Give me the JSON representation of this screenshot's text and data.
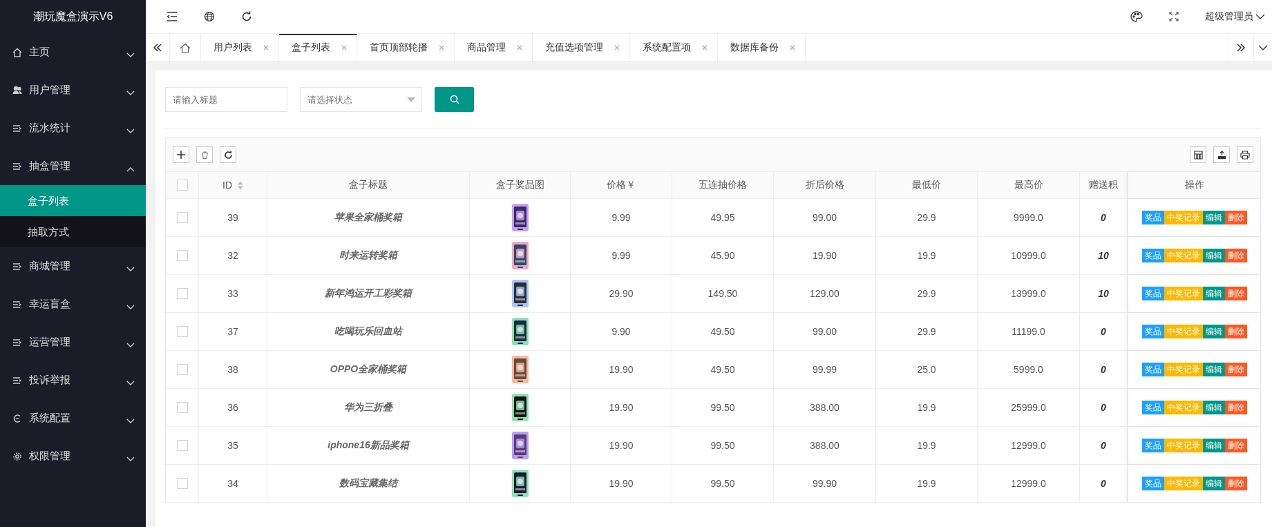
{
  "sidebar": {
    "title": "潮玩魔盒演示V6",
    "items": [
      {
        "label": "主页",
        "kind": "home",
        "expanded": false
      },
      {
        "label": "用户管理",
        "kind": "users",
        "expanded": false
      },
      {
        "label": "流水统计",
        "kind": "list",
        "expanded": false
      },
      {
        "label": "抽盒管理",
        "kind": "list",
        "expanded": true,
        "children": [
          {
            "label": "盒子列表",
            "selected": true
          },
          {
            "label": "抽取方式",
            "selected": false
          }
        ]
      },
      {
        "label": "商城管理",
        "kind": "list",
        "expanded": false
      },
      {
        "label": "幸运盲盒",
        "kind": "list",
        "expanded": false
      },
      {
        "label": "运营管理",
        "kind": "list",
        "expanded": false
      },
      {
        "label": "投诉举报",
        "kind": "list",
        "expanded": false
      },
      {
        "label": "系统配置",
        "kind": "cycle",
        "expanded": false
      },
      {
        "label": "权限管理",
        "kind": "gear",
        "expanded": false
      }
    ]
  },
  "header": {
    "user": "超级管理员"
  },
  "tabs": [
    {
      "label": "用户列表",
      "selected": false
    },
    {
      "label": "盒子列表",
      "selected": true
    },
    {
      "label": "首页顶部轮播",
      "selected": false
    },
    {
      "label": "商品管理",
      "selected": false
    },
    {
      "label": "充值选项管理",
      "selected": false
    },
    {
      "label": "系统配置项",
      "selected": false
    },
    {
      "label": "数据库备份",
      "selected": false
    }
  ],
  "filters": {
    "title_placeholder": "请输入标题",
    "status_placeholder": "请选择状态"
  },
  "table": {
    "select_all_checked": false,
    "columns": [
      "ID",
      "盒子标题",
      "盒子奖品图",
      "价格￥",
      "五连抽价格",
      "折后价格",
      "最低价",
      "最高价",
      "赠送积",
      "操作"
    ],
    "rows": [
      {
        "checked": false,
        "id": "39",
        "title": "苹果全家桶奖箱",
        "price": "9.99",
        "five": "49.95",
        "discount": "99.00",
        "min": "29.9",
        "max": "9999.0",
        "points": "0",
        "actions": [
          {
            "label": "奖品",
            "kind": "info"
          },
          {
            "label": "中奖记录",
            "kind": "warn"
          },
          {
            "label": "编辑",
            "kind": "primary"
          },
          {
            "label": "删除",
            "kind": "danger"
          }
        ]
      },
      {
        "checked": false,
        "id": "32",
        "title": "时来运转奖箱",
        "price": "9.99",
        "five": "45.90",
        "discount": "19.90",
        "min": "19.9",
        "max": "10999.0",
        "points": "10",
        "actions": [
          {
            "label": "奖品",
            "kind": "info"
          },
          {
            "label": "中奖记录",
            "kind": "warn"
          },
          {
            "label": "编辑",
            "kind": "primary"
          },
          {
            "label": "删除",
            "kind": "danger"
          }
        ]
      },
      {
        "checked": false,
        "id": "33",
        "title": "新年鸿运开工彩奖箱",
        "price": "29.90",
        "five": "149.50",
        "discount": "129.00",
        "min": "29.9",
        "max": "13999.0",
        "points": "10",
        "actions": [
          {
            "label": "奖品",
            "kind": "info"
          },
          {
            "label": "中奖记录",
            "kind": "warn"
          },
          {
            "label": "编辑",
            "kind": "primary"
          },
          {
            "label": "删除",
            "kind": "danger"
          }
        ]
      },
      {
        "checked": false,
        "id": "37",
        "title": "吃喝玩乐回血站",
        "price": "9.90",
        "five": "49.50",
        "discount": "99.00",
        "min": "29.9",
        "max": "11199.0",
        "points": "0",
        "actions": [
          {
            "label": "奖品",
            "kind": "info"
          },
          {
            "label": "中奖记录",
            "kind": "warn"
          },
          {
            "label": "编辑",
            "kind": "primary"
          },
          {
            "label": "删除",
            "kind": "danger"
          }
        ]
      },
      {
        "checked": false,
        "id": "38",
        "title": "OPPO全家桶奖箱",
        "price": "19.90",
        "five": "49.50",
        "discount": "99.99",
        "min": "25.0",
        "max": "5999.0",
        "points": "0",
        "actions": [
          {
            "label": "奖品",
            "kind": "info"
          },
          {
            "label": "中奖记录",
            "kind": "warn"
          },
          {
            "label": "编辑",
            "kind": "primary"
          },
          {
            "label": "删除",
            "kind": "danger"
          }
        ]
      },
      {
        "checked": false,
        "id": "36",
        "title": "华为三折叠",
        "price": "19.90",
        "five": "99.50",
        "discount": "388.00",
        "min": "19.9",
        "max": "25999.0",
        "points": "0",
        "actions": [
          {
            "label": "奖品",
            "kind": "info"
          },
          {
            "label": "中奖记录",
            "kind": "warn"
          },
          {
            "label": "编辑",
            "kind": "primary"
          },
          {
            "label": "删除",
            "kind": "danger"
          }
        ]
      },
      {
        "checked": false,
        "id": "35",
        "title": "iphone16新品奖箱",
        "price": "19.90",
        "five": "99.50",
        "discount": "388.00",
        "min": "19.9",
        "max": "12999.0",
        "points": "0",
        "actions": [
          {
            "label": "奖品",
            "kind": "info"
          },
          {
            "label": "中奖记录",
            "kind": "warn"
          },
          {
            "label": "编辑",
            "kind": "primary"
          },
          {
            "label": "删除",
            "kind": "danger"
          }
        ]
      },
      {
        "checked": false,
        "id": "34",
        "title": "数码宝藏集结",
        "price": "19.90",
        "five": "99.50",
        "discount": "99.90",
        "min": "19.9",
        "max": "12999.0",
        "points": "0",
        "actions": [
          {
            "label": "奖品",
            "kind": "info"
          },
          {
            "label": "中奖记录",
            "kind": "warn"
          },
          {
            "label": "编辑",
            "kind": "primary"
          },
          {
            "label": "删除",
            "kind": "danger"
          }
        ]
      }
    ]
  }
}
